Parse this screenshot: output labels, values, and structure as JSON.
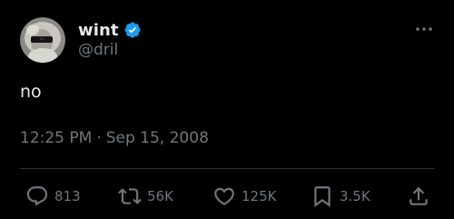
{
  "author": {
    "display_name": "wint",
    "handle": "@dril",
    "verified": true,
    "verified_color": "#1d9bf0"
  },
  "tweet": {
    "text": "no",
    "time": "12:25 PM",
    "separator": "·",
    "date": "Sep 15, 2008"
  },
  "actions": {
    "replies": "813",
    "reposts": "56K",
    "likes": "125K",
    "bookmarks": "3.5K"
  },
  "icons": {
    "more": "more-dots-icon",
    "reply": "reply-bubble-icon",
    "repost": "repost-arrows-icon",
    "like": "heart-icon",
    "bookmark": "bookmark-icon",
    "share": "share-upload-icon"
  },
  "colors": {
    "background": "#000000",
    "text_primary": "#e7e9ea",
    "text_secondary": "#71767b",
    "divider": "#2f3336"
  }
}
